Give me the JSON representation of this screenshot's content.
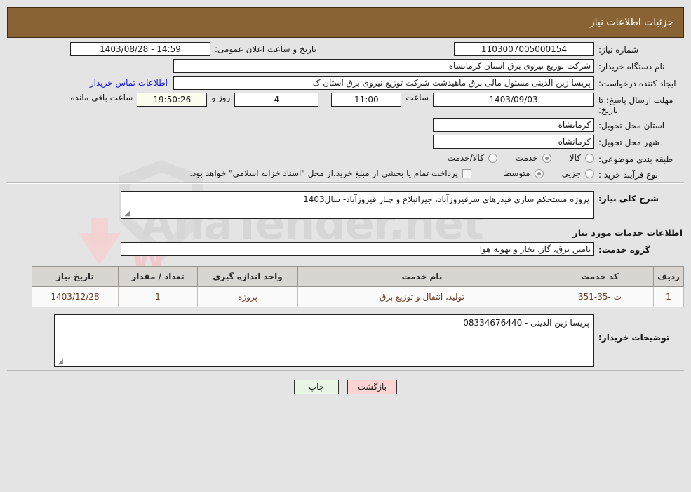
{
  "header": {
    "title": "جزئیات اطلاعات نیاز"
  },
  "watermark": {
    "text_left": "Ana",
    "text_right": "Tender",
    "suffix": ".net"
  },
  "form": {
    "need_number": {
      "label": "شماره نیاز:",
      "value": "1103007005000154"
    },
    "announce_datetime": {
      "label": "تاریخ و ساعت اعلان عمومی:",
      "value": "14:59 - 1403/08/28"
    },
    "buyer_org": {
      "label": "نام دستگاه خریدار:",
      "value": "شرکت توزیع نیروی برق استان کرمانشاه"
    },
    "requester": {
      "label": "ایجاد کننده درخواست:",
      "value": "پریسا زین الدینی مسئول مالی برق ماهیدشت شرکت توزیع نیروی برق استان ک"
    },
    "contact_link": "اطلاعات تماس خریدار",
    "deadline": {
      "label": "مهلت ارسال پاسخ: تا تاریخ:",
      "date": "1403/09/03",
      "hour_label": "ساعت",
      "hour": "11:00",
      "days": "4",
      "days_label": "روز و",
      "countdown": "19:50:26",
      "countdown_label": "ساعت باقي مانده"
    },
    "province": {
      "label": "استان محل تحویل:",
      "value": "کرمانشاه"
    },
    "city": {
      "label": "شهر محل تحویل:",
      "value": "کرمانشاه"
    },
    "category": {
      "label": "طبقه بندی موضوعی:",
      "options": [
        {
          "label": "کالا",
          "selected": false
        },
        {
          "label": "خدمت",
          "selected": true
        },
        {
          "label": "کالا/خدمت",
          "selected": false
        }
      ]
    },
    "purchase_type": {
      "label": "نوع فرآیند خرید :",
      "options": [
        {
          "label": "جزیي",
          "selected": false
        },
        {
          "label": "متوسط",
          "selected": true
        }
      ],
      "checkbox_label": "پرداخت تمام یا بخشی از مبلغ خرید،از محل \"اسناد خزانه اسلامی\" خواهد بود.",
      "checkbox_checked": false
    },
    "general_description": {
      "label": "شرح کلی نیاز:",
      "value": "پروژه مستحکم سازی فیدرهای سرفیروزآباد، جیرانبلاغ و چنار فیروزآباد- سال1403"
    },
    "services_section_title": "اطلاعات خدمات مورد نیاز",
    "service_group": {
      "label": "گروه خدمت:",
      "value": "تامین برق، گاز، بخار و تهویه هوا"
    },
    "buyer_comments": {
      "label": "توضیحات خریدار:",
      "value": "پریسا زین الدینی - 08334676440"
    }
  },
  "table": {
    "columns": [
      "ردیف",
      "کد خدمت",
      "نام خدمت",
      "واحد اندازه گیری",
      "تعداد / مقدار",
      "تاریخ نیاز"
    ],
    "rows": [
      {
        "row": "1",
        "code": "ت -35-351",
        "name": "تولید، انتقال و توزیع برق",
        "unit": "پروژه",
        "qty": "1",
        "date": "1403/12/28"
      }
    ]
  },
  "buttons": {
    "print": "چاپ",
    "back": "بازگشت"
  }
}
